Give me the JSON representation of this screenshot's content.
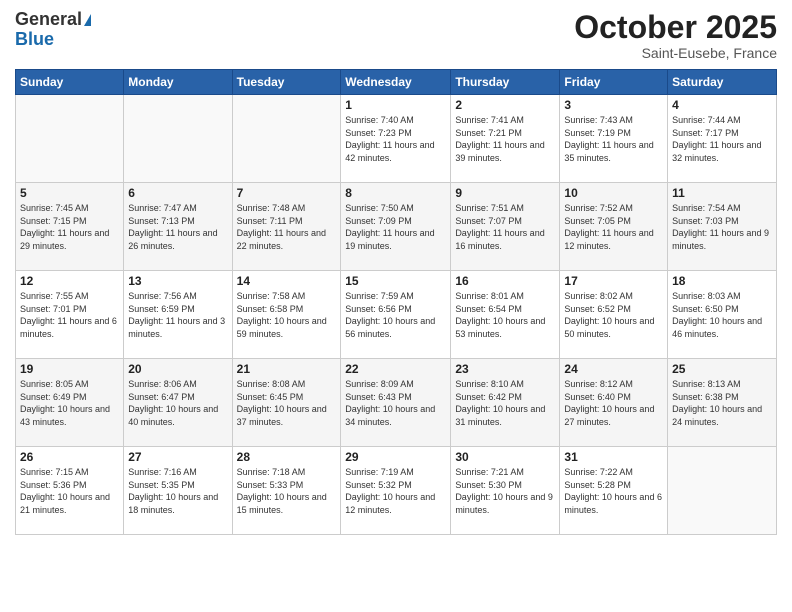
{
  "header": {
    "logo_general": "General",
    "logo_blue": "Blue",
    "title": "October 2025",
    "location": "Saint-Eusebe, France"
  },
  "days_of_week": [
    "Sunday",
    "Monday",
    "Tuesday",
    "Wednesday",
    "Thursday",
    "Friday",
    "Saturday"
  ],
  "weeks": [
    [
      {
        "day": "",
        "sunrise": "",
        "sunset": "",
        "daylight": ""
      },
      {
        "day": "",
        "sunrise": "",
        "sunset": "",
        "daylight": ""
      },
      {
        "day": "",
        "sunrise": "",
        "sunset": "",
        "daylight": ""
      },
      {
        "day": "1",
        "sunrise": "Sunrise: 7:40 AM",
        "sunset": "Sunset: 7:23 PM",
        "daylight": "Daylight: 11 hours and 42 minutes."
      },
      {
        "day": "2",
        "sunrise": "Sunrise: 7:41 AM",
        "sunset": "Sunset: 7:21 PM",
        "daylight": "Daylight: 11 hours and 39 minutes."
      },
      {
        "day": "3",
        "sunrise": "Sunrise: 7:43 AM",
        "sunset": "Sunset: 7:19 PM",
        "daylight": "Daylight: 11 hours and 35 minutes."
      },
      {
        "day": "4",
        "sunrise": "Sunrise: 7:44 AM",
        "sunset": "Sunset: 7:17 PM",
        "daylight": "Daylight: 11 hours and 32 minutes."
      }
    ],
    [
      {
        "day": "5",
        "sunrise": "Sunrise: 7:45 AM",
        "sunset": "Sunset: 7:15 PM",
        "daylight": "Daylight: 11 hours and 29 minutes."
      },
      {
        "day": "6",
        "sunrise": "Sunrise: 7:47 AM",
        "sunset": "Sunset: 7:13 PM",
        "daylight": "Daylight: 11 hours and 26 minutes."
      },
      {
        "day": "7",
        "sunrise": "Sunrise: 7:48 AM",
        "sunset": "Sunset: 7:11 PM",
        "daylight": "Daylight: 11 hours and 22 minutes."
      },
      {
        "day": "8",
        "sunrise": "Sunrise: 7:50 AM",
        "sunset": "Sunset: 7:09 PM",
        "daylight": "Daylight: 11 hours and 19 minutes."
      },
      {
        "day": "9",
        "sunrise": "Sunrise: 7:51 AM",
        "sunset": "Sunset: 7:07 PM",
        "daylight": "Daylight: 11 hours and 16 minutes."
      },
      {
        "day": "10",
        "sunrise": "Sunrise: 7:52 AM",
        "sunset": "Sunset: 7:05 PM",
        "daylight": "Daylight: 11 hours and 12 minutes."
      },
      {
        "day": "11",
        "sunrise": "Sunrise: 7:54 AM",
        "sunset": "Sunset: 7:03 PM",
        "daylight": "Daylight: 11 hours and 9 minutes."
      }
    ],
    [
      {
        "day": "12",
        "sunrise": "Sunrise: 7:55 AM",
        "sunset": "Sunset: 7:01 PM",
        "daylight": "Daylight: 11 hours and 6 minutes."
      },
      {
        "day": "13",
        "sunrise": "Sunrise: 7:56 AM",
        "sunset": "Sunset: 6:59 PM",
        "daylight": "Daylight: 11 hours and 3 minutes."
      },
      {
        "day": "14",
        "sunrise": "Sunrise: 7:58 AM",
        "sunset": "Sunset: 6:58 PM",
        "daylight": "Daylight: 10 hours and 59 minutes."
      },
      {
        "day": "15",
        "sunrise": "Sunrise: 7:59 AM",
        "sunset": "Sunset: 6:56 PM",
        "daylight": "Daylight: 10 hours and 56 minutes."
      },
      {
        "day": "16",
        "sunrise": "Sunrise: 8:01 AM",
        "sunset": "Sunset: 6:54 PM",
        "daylight": "Daylight: 10 hours and 53 minutes."
      },
      {
        "day": "17",
        "sunrise": "Sunrise: 8:02 AM",
        "sunset": "Sunset: 6:52 PM",
        "daylight": "Daylight: 10 hours and 50 minutes."
      },
      {
        "day": "18",
        "sunrise": "Sunrise: 8:03 AM",
        "sunset": "Sunset: 6:50 PM",
        "daylight": "Daylight: 10 hours and 46 minutes."
      }
    ],
    [
      {
        "day": "19",
        "sunrise": "Sunrise: 8:05 AM",
        "sunset": "Sunset: 6:49 PM",
        "daylight": "Daylight: 10 hours and 43 minutes."
      },
      {
        "day": "20",
        "sunrise": "Sunrise: 8:06 AM",
        "sunset": "Sunset: 6:47 PM",
        "daylight": "Daylight: 10 hours and 40 minutes."
      },
      {
        "day": "21",
        "sunrise": "Sunrise: 8:08 AM",
        "sunset": "Sunset: 6:45 PM",
        "daylight": "Daylight: 10 hours and 37 minutes."
      },
      {
        "day": "22",
        "sunrise": "Sunrise: 8:09 AM",
        "sunset": "Sunset: 6:43 PM",
        "daylight": "Daylight: 10 hours and 34 minutes."
      },
      {
        "day": "23",
        "sunrise": "Sunrise: 8:10 AM",
        "sunset": "Sunset: 6:42 PM",
        "daylight": "Daylight: 10 hours and 31 minutes."
      },
      {
        "day": "24",
        "sunrise": "Sunrise: 8:12 AM",
        "sunset": "Sunset: 6:40 PM",
        "daylight": "Daylight: 10 hours and 27 minutes."
      },
      {
        "day": "25",
        "sunrise": "Sunrise: 8:13 AM",
        "sunset": "Sunset: 6:38 PM",
        "daylight": "Daylight: 10 hours and 24 minutes."
      }
    ],
    [
      {
        "day": "26",
        "sunrise": "Sunrise: 7:15 AM",
        "sunset": "Sunset: 5:36 PM",
        "daylight": "Daylight: 10 hours and 21 minutes."
      },
      {
        "day": "27",
        "sunrise": "Sunrise: 7:16 AM",
        "sunset": "Sunset: 5:35 PM",
        "daylight": "Daylight: 10 hours and 18 minutes."
      },
      {
        "day": "28",
        "sunrise": "Sunrise: 7:18 AM",
        "sunset": "Sunset: 5:33 PM",
        "daylight": "Daylight: 10 hours and 15 minutes."
      },
      {
        "day": "29",
        "sunrise": "Sunrise: 7:19 AM",
        "sunset": "Sunset: 5:32 PM",
        "daylight": "Daylight: 10 hours and 12 minutes."
      },
      {
        "day": "30",
        "sunrise": "Sunrise: 7:21 AM",
        "sunset": "Sunset: 5:30 PM",
        "daylight": "Daylight: 10 hours and 9 minutes."
      },
      {
        "day": "31",
        "sunrise": "Sunrise: 7:22 AM",
        "sunset": "Sunset: 5:28 PM",
        "daylight": "Daylight: 10 hours and 6 minutes."
      },
      {
        "day": "",
        "sunrise": "",
        "sunset": "",
        "daylight": ""
      }
    ]
  ]
}
